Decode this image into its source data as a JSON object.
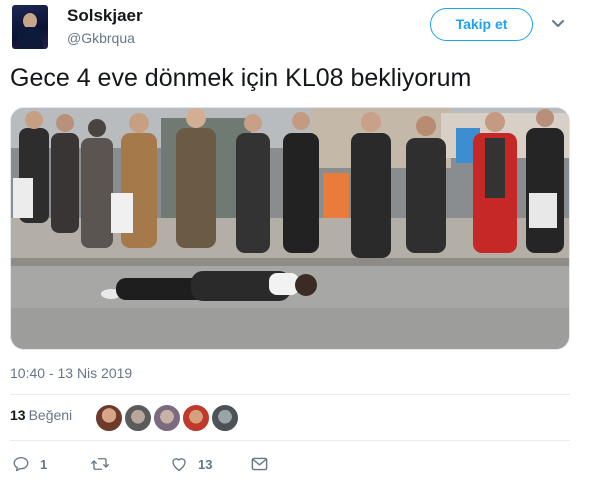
{
  "author": {
    "name": "Solskjaer",
    "handle": "@Gkbrqua"
  },
  "follow_button": {
    "label": "Takip et"
  },
  "tweet": {
    "text": "Gece 4 eve dönmek için KL08 bekliyorum",
    "timestamp": "10:40 - 13 Nis 2019"
  },
  "stats": {
    "likes_count": "13",
    "likes_label": "Beğeni"
  },
  "actions": {
    "reply_count": "1",
    "retweet_count": "",
    "like_count": "13"
  },
  "icons": [
    "reply-icon",
    "retweet-icon",
    "like-icon",
    "message-icon",
    "chevron-down-icon"
  ],
  "colors": {
    "accent": "#1da1f2",
    "text": "#14171a",
    "muted": "#657786",
    "divider": "#e6ecf0"
  }
}
